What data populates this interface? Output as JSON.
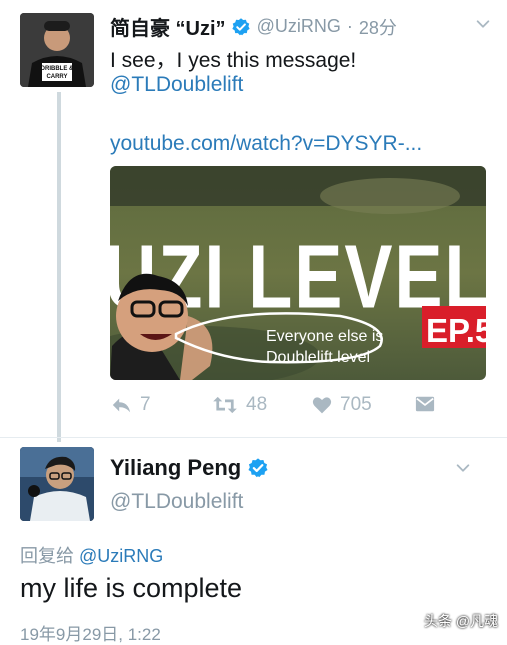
{
  "tweet1": {
    "author_name": "简自豪 “Uzi”",
    "handle": "@UziRNG",
    "separator": "·",
    "time": "28分",
    "text": "I see，I yes this message!",
    "mention": "@TLDoublelift",
    "url": "youtube.com/watch?v=DYSYR-...",
    "avatar_shirt_line1": "DRIBBLE &",
    "avatar_shirt_line2": "CARRY",
    "media": {
      "headline": "UZI LEVEL",
      "episode": "EP.5",
      "caption_line1": "Everyone else is",
      "caption_line2": "Doublelift level"
    },
    "actions": {
      "reply_count": "7",
      "retweet_count": "48",
      "like_count": "705"
    }
  },
  "tweet2": {
    "author_name": "Yiliang Peng",
    "handle": "@TLDoublelift",
    "reply_prefix": "回复给",
    "reply_to": "@UziRNG",
    "text": "my life is complete",
    "timestamp": "19年9月29日, 1:22"
  },
  "watermark": "头条 @凡魂",
  "colors": {
    "verified": "#1da1f2",
    "link": "#2b7bb9",
    "muted": "#8899a6",
    "ep_red": "#d91e2a"
  }
}
